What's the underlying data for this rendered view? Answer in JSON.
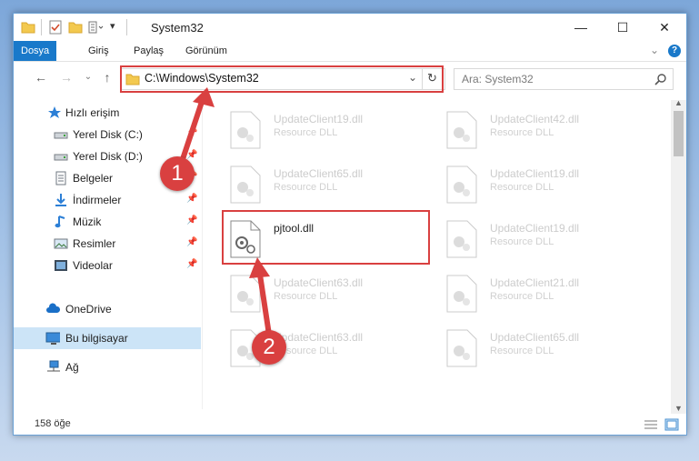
{
  "window": {
    "title": "System32",
    "minimize_glyph": "—",
    "maximize_glyph": "☐",
    "close_glyph": "✕"
  },
  "ribbon": {
    "tabs": [
      "Dosya",
      "Giriş",
      "Paylaş",
      "Görünüm"
    ]
  },
  "nav": {
    "path": "C:\\Windows\\System32",
    "search_placeholder": "Ara: System32"
  },
  "sidebar": {
    "items": [
      {
        "label": "Hızlı erişim",
        "icon": "star-icon"
      },
      {
        "label": "Yerel Disk (C:)",
        "icon": "drive-icon",
        "pinned": true
      },
      {
        "label": "Yerel Disk (D:)",
        "icon": "drive-icon",
        "pinned": true
      },
      {
        "label": "Belgeler",
        "icon": "documents-icon",
        "pinned": true
      },
      {
        "label": "İndirmeler",
        "icon": "download-icon",
        "pinned": true
      },
      {
        "label": "Müzik",
        "icon": "music-icon",
        "pinned": true
      },
      {
        "label": "Resimler",
        "icon": "pictures-icon",
        "pinned": true
      },
      {
        "label": "Videolar",
        "icon": "videos-icon",
        "pinned": true
      },
      {
        "label": "OneDrive",
        "icon": "cloud-icon"
      },
      {
        "label": "Bu bilgisayar",
        "icon": "computer-icon",
        "selected": true
      },
      {
        "label": "Ağ",
        "icon": "network-icon"
      }
    ]
  },
  "files": {
    "left": [
      {
        "name": "UpdateClient19.dll",
        "desc": "Resource DLL"
      },
      {
        "name": "UpdateClient65.dll",
        "desc": "Resource DLL"
      },
      {
        "name": "pjtool.dll",
        "desc": ""
      },
      {
        "name": "UpdateClient63.dll",
        "desc": "Resource DLL"
      },
      {
        "name": "UpdateClient63.dll",
        "desc": "Resource DLL"
      }
    ],
    "right": [
      {
        "name": "UpdateClient42.dll",
        "desc": "Resource DLL"
      },
      {
        "name": "UpdateClient19.dll",
        "desc": "Resource DLL"
      },
      {
        "name": "UpdateClient19.dll",
        "desc": "Resource DLL"
      },
      {
        "name": "UpdateClient21.dll",
        "desc": "Resource DLL"
      },
      {
        "name": "UpdateClient65.dll",
        "desc": "Resource DLL"
      }
    ]
  },
  "status": {
    "count": "158 öğe"
  },
  "annotations": {
    "badge1": "1",
    "badge2": "2",
    "color": "#d94040"
  }
}
